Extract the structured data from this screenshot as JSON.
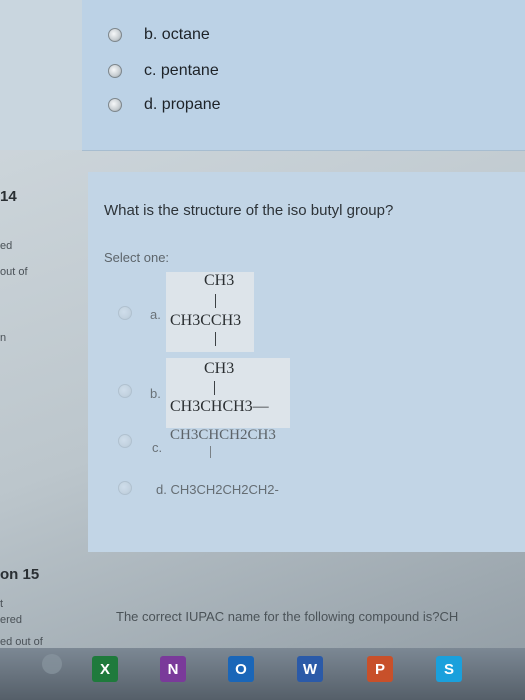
{
  "previous_question": {
    "options": [
      {
        "label": "b. octane"
      },
      {
        "label": "c. pentane"
      },
      {
        "label": "d. propane"
      }
    ]
  },
  "question14": {
    "number_label": "14",
    "status_partial": "ed",
    "marks_partial": "out of",
    "meta_a": "",
    "meta_b": "n",
    "text": "What is the structure of the iso butyl group?",
    "select_one": "Select one:",
    "choices": [
      {
        "letter": "a.",
        "top": "CH3",
        "main": "CH3CCH3"
      },
      {
        "letter": "b.",
        "top": "CH3",
        "main": "CH3CHCH3—"
      },
      {
        "letter": "c.",
        "main": "CH3CHCH2CH3"
      },
      {
        "letter": "d.",
        "main": "CH3CH2CH2CH2-"
      }
    ]
  },
  "question15": {
    "number_label": "on 15",
    "meta_a": "ered",
    "meta_b": "ed out of",
    "text": "The correct IUPAC name for the following compound is?CH"
  },
  "taskbar": {
    "icons": [
      {
        "name": "excel-icon",
        "glyph": "X",
        "color": "#1f7a3c"
      },
      {
        "name": "onenote-icon",
        "glyph": "N",
        "color": "#7a3a9a"
      },
      {
        "name": "outlook-icon",
        "glyph": "O",
        "color": "#1a66b8"
      },
      {
        "name": "word-icon",
        "glyph": "W",
        "color": "#2b5aa8"
      },
      {
        "name": "powerpoint-icon",
        "glyph": "P",
        "color": "#c8502a"
      },
      {
        "name": "skype-icon",
        "glyph": "S",
        "color": "#1aa0dc"
      }
    ]
  }
}
